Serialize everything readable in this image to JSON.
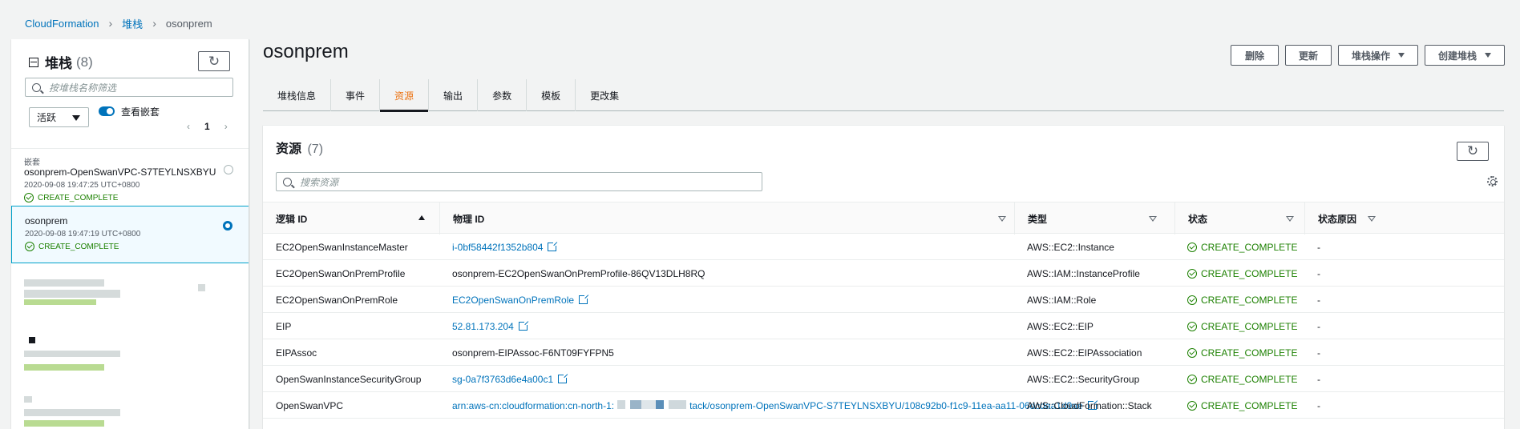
{
  "breadcrumb": {
    "root": "CloudFormation",
    "mid": "堆栈",
    "current": "osonprem"
  },
  "left": {
    "title": "堆栈",
    "count": "(8)",
    "search_placeholder": "按堆栈名称筛选",
    "filter_value": "活跃",
    "nested_label": "查看嵌套",
    "page": "1",
    "items": [
      {
        "tag": "嵌套",
        "name": "osonprem-OpenSwanVPC-S7TEYLNSXBYU",
        "time": "2020-09-08 19:47:25 UTC+0800",
        "status": "CREATE_COMPLETE"
      },
      {
        "name": "osonprem",
        "time": "2020-09-08 19:47:19 UTC+0800",
        "status": "CREATE_COMPLETE"
      }
    ]
  },
  "main": {
    "title": "osonprem",
    "buttons": {
      "delete": "删除",
      "update": "更新",
      "stack_actions": "堆栈操作",
      "create": "创建堆栈"
    },
    "tabs": [
      "堆栈信息",
      "事件",
      "资源",
      "输出",
      "参数",
      "模板",
      "更改集"
    ],
    "resources": {
      "title": "资源",
      "count": "(7)",
      "search_placeholder": "搜索资源",
      "columns": {
        "logical": "逻辑 ID",
        "physical": "物理 ID",
        "type": "类型",
        "status": "状态",
        "reason": "状态原因"
      },
      "rows": [
        {
          "logical": "EC2OpenSwanInstanceMaster",
          "physical": "i-0bf58442f1352b804",
          "link": true,
          "type": "AWS::EC2::Instance",
          "status": "CREATE_COMPLETE",
          "reason": "-"
        },
        {
          "logical": "EC2OpenSwanOnPremProfile",
          "physical": "osonprem-EC2OpenSwanOnPremProfile-86QV13DLH8RQ",
          "link": false,
          "type": "AWS::IAM::InstanceProfile",
          "status": "CREATE_COMPLETE",
          "reason": "-"
        },
        {
          "logical": "EC2OpenSwanOnPremRole",
          "physical": "EC2OpenSwanOnPremRole",
          "link": true,
          "type": "AWS::IAM::Role",
          "status": "CREATE_COMPLETE",
          "reason": "-"
        },
        {
          "logical": "EIP",
          "physical": "52.81.173.204",
          "link": true,
          "type": "AWS::EC2::EIP",
          "status": "CREATE_COMPLETE",
          "reason": "-"
        },
        {
          "logical": "EIPAssoc",
          "physical": "osonprem-EIPAssoc-F6NT09FYFPN5",
          "link": false,
          "type": "AWS::EC2::EIPAssociation",
          "status": "CREATE_COMPLETE",
          "reason": "-"
        },
        {
          "logical": "OpenSwanInstanceSecurityGroup",
          "physical": "sg-0a7f3763d6e4a00c1",
          "link": true,
          "type": "AWS::EC2::SecurityGroup",
          "status": "CREATE_COMPLETE",
          "reason": "-"
        },
        {
          "logical": "OpenSwanVPC",
          "physical": "arn:aws-cn:cloudformation:cn-north-1:",
          "physical_tail": "tack/osonprem-OpenSwanVPC-S7TEYLNSXBYU/108c92b0-f1c9-11ea-aa11-06dcdaa1d9ae",
          "link": true,
          "type": "AWS::CloudFormation::Stack",
          "status": "CREATE_COMPLETE",
          "reason": "-"
        }
      ]
    }
  },
  "colors": {
    "link": "#0073bb",
    "success": "#1d8102",
    "active_tab": "#ec7211"
  },
  "icons": {
    "refresh": "refresh-icon",
    "search": "search-icon",
    "settings": "gear-icon",
    "external": "external-link-icon",
    "status": "check-circle-icon"
  }
}
